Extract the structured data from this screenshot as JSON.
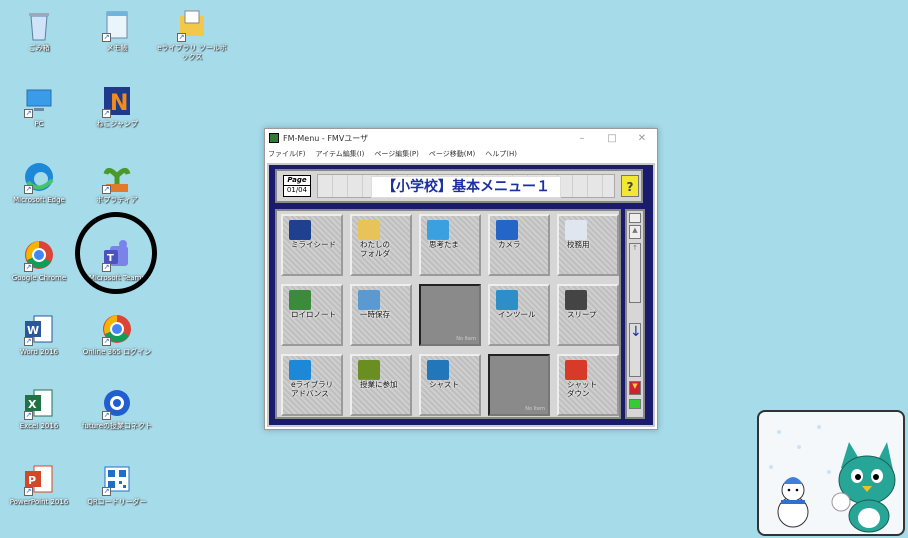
{
  "desktop": {
    "icons": [
      {
        "label": "ごみ箱"
      },
      {
        "label": "メモ帳"
      },
      {
        "label": "eライブラリ ツールボックス"
      },
      {
        "label": "PC"
      },
      {
        "label": "ねこジャンプ"
      },
      {
        "label": "Microsoft Edge"
      },
      {
        "label": "ポプラディア"
      },
      {
        "label": "Google Chrome"
      },
      {
        "label": "Microsoft Teams"
      },
      {
        "label": "Word 2016"
      },
      {
        "label": "Online 365 ログイン"
      },
      {
        "label": "Excel 2016"
      },
      {
        "label": "futureの授業コネクト"
      },
      {
        "label": "PowerPoint 2016"
      },
      {
        "label": "QRコードリーダー"
      }
    ],
    "highlight_color": "#000000",
    "background_color": "#a6dbea"
  },
  "window": {
    "title": "FM-Menu - FMVユーザ",
    "menu": [
      "ファイル(F)",
      "アイテム編集(I)",
      "ページ編集(P)",
      "ページ移動(M)",
      "ヘルプ(H)"
    ],
    "page_label": "Page",
    "page_number": "01/04",
    "menu_title": "【小学校】基本メニュー１",
    "help": "?",
    "tiles": [
      {
        "label": "ミライシード",
        "icon": "miraiseed-icon",
        "color": "#1f3f8f"
      },
      {
        "label": "わたしの\nフォルダ",
        "icon": "folder-icon",
        "color": "#e8c35a"
      },
      {
        "label": "思考たま",
        "icon": "shikotama-icon",
        "color": "#3aa0e0"
      },
      {
        "label": "カメラ",
        "icon": "camera-icon",
        "color": "#2466c8"
      },
      {
        "label": "校務用",
        "icon": "im-icon",
        "color": "#dfe6f0"
      },
      {
        "label": "ロイロノート",
        "icon": "loilo-icon",
        "color": "#3c8a3c"
      },
      {
        "label": "一時保存",
        "icon": "temp-save-icon",
        "color": "#5a9ad0"
      },
      {
        "label": "",
        "icon": "",
        "empty": true
      },
      {
        "label": "インツール",
        "icon": "intool-icon",
        "color": "#2e8ec8"
      },
      {
        "label": "スリープ",
        "icon": "sleep-icon",
        "color": "#444444"
      },
      {
        "label": "eライブラリ\nアドバンス",
        "icon": "elibrary-icon",
        "color": "#1e88d8"
      },
      {
        "label": "授業に参加",
        "icon": "join-class-icon",
        "color": "#6b8e23"
      },
      {
        "label": "シャスト",
        "icon": "globe-icon",
        "color": "#2277bb"
      },
      {
        "label": "",
        "icon": "",
        "empty": true
      },
      {
        "label": "シャット\nダウン",
        "icon": "shutdown-icon",
        "color": "#d83a2a"
      }
    ],
    "no_item": "No Item"
  }
}
